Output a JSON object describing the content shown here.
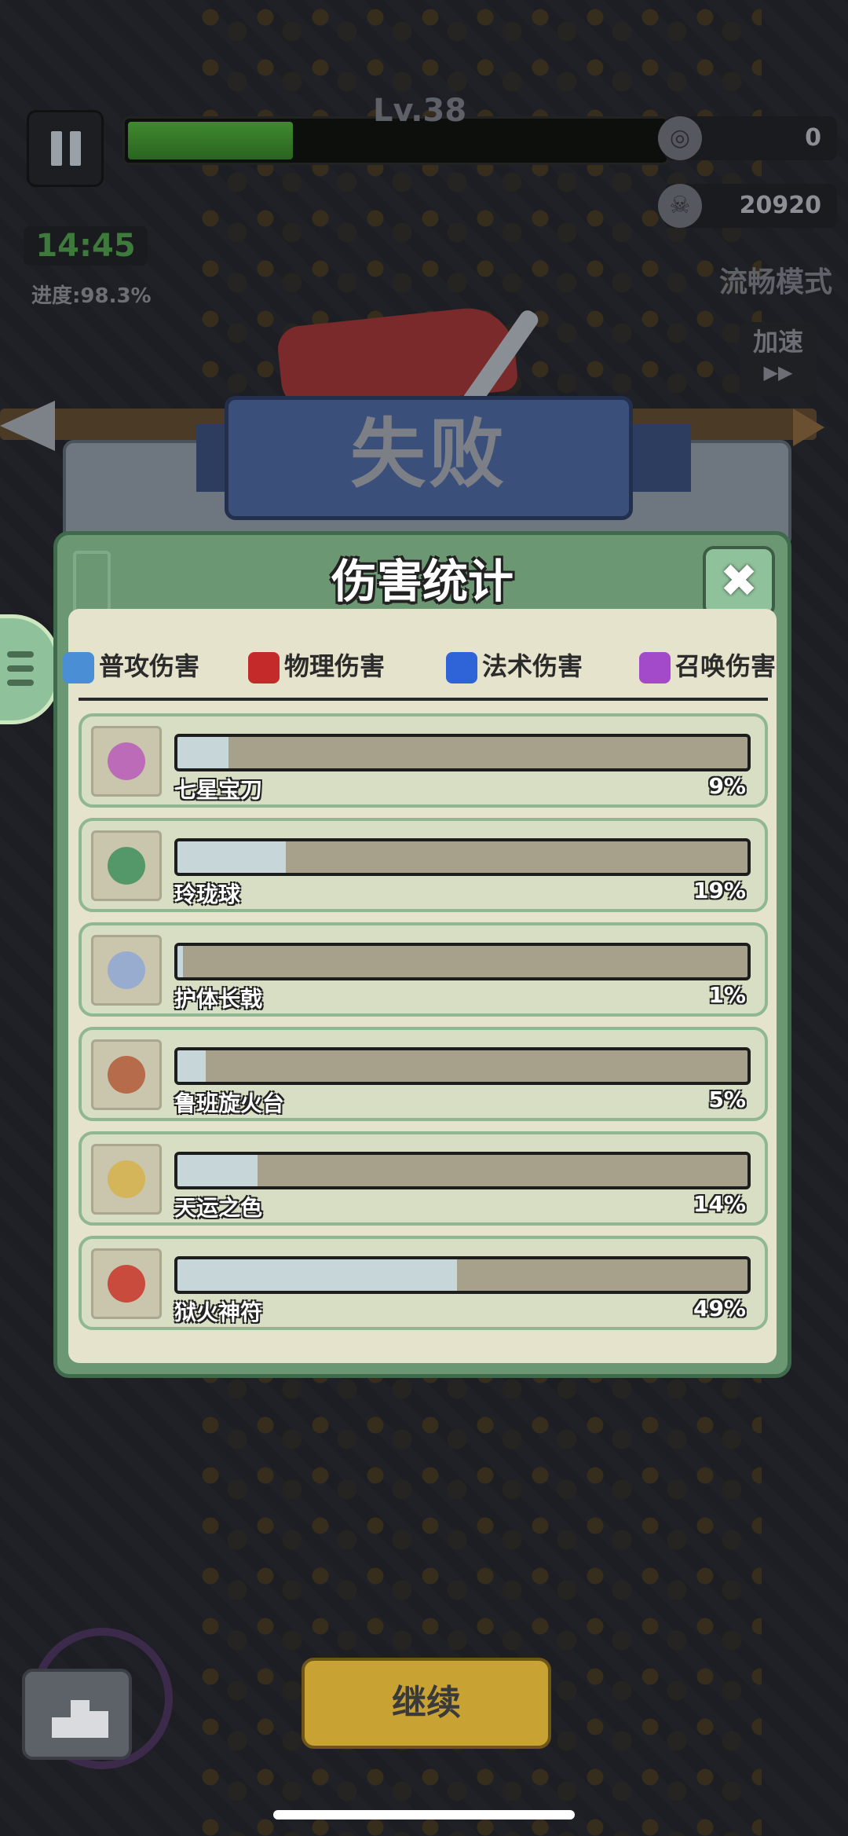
{
  "hud": {
    "level": "Lv.38",
    "coins": "0",
    "kills": "20920",
    "timer": "14:45",
    "progress": "进度:98.3%",
    "mode": "流畅模式",
    "speed": "加速"
  },
  "banner": {
    "result": "失败"
  },
  "panel": {
    "title": "伤害统计",
    "close": "✖",
    "tabs": [
      {
        "label": "普攻伤害",
        "color": "#4a8fd6"
      },
      {
        "label": "物理伤害",
        "color": "#c42a2a"
      },
      {
        "label": "法术伤害",
        "color": "#2f63d8"
      },
      {
        "label": "召唤伤害",
        "color": "#a24ac9"
      }
    ],
    "rows": [
      {
        "name": "七星宝刀",
        "pct": "9%",
        "value": 0.09,
        "icon": "dagger-icon"
      },
      {
        "name": "玲珑球",
        "pct": "19%",
        "value": 0.19,
        "icon": "orb-icon"
      },
      {
        "name": "护体长戟",
        "pct": "1%",
        "value": 0.01,
        "icon": "halberd-icon"
      },
      {
        "name": "鲁班旋火台",
        "pct": "5%",
        "value": 0.05,
        "icon": "fire-tower-icon"
      },
      {
        "name": "天运之色",
        "pct": "14%",
        "value": 0.14,
        "icon": "dice-icon"
      },
      {
        "name": "狱火神符",
        "pct": "49%",
        "value": 0.49,
        "icon": "talisman-icon"
      }
    ]
  },
  "footer": {
    "continue": "继续"
  }
}
